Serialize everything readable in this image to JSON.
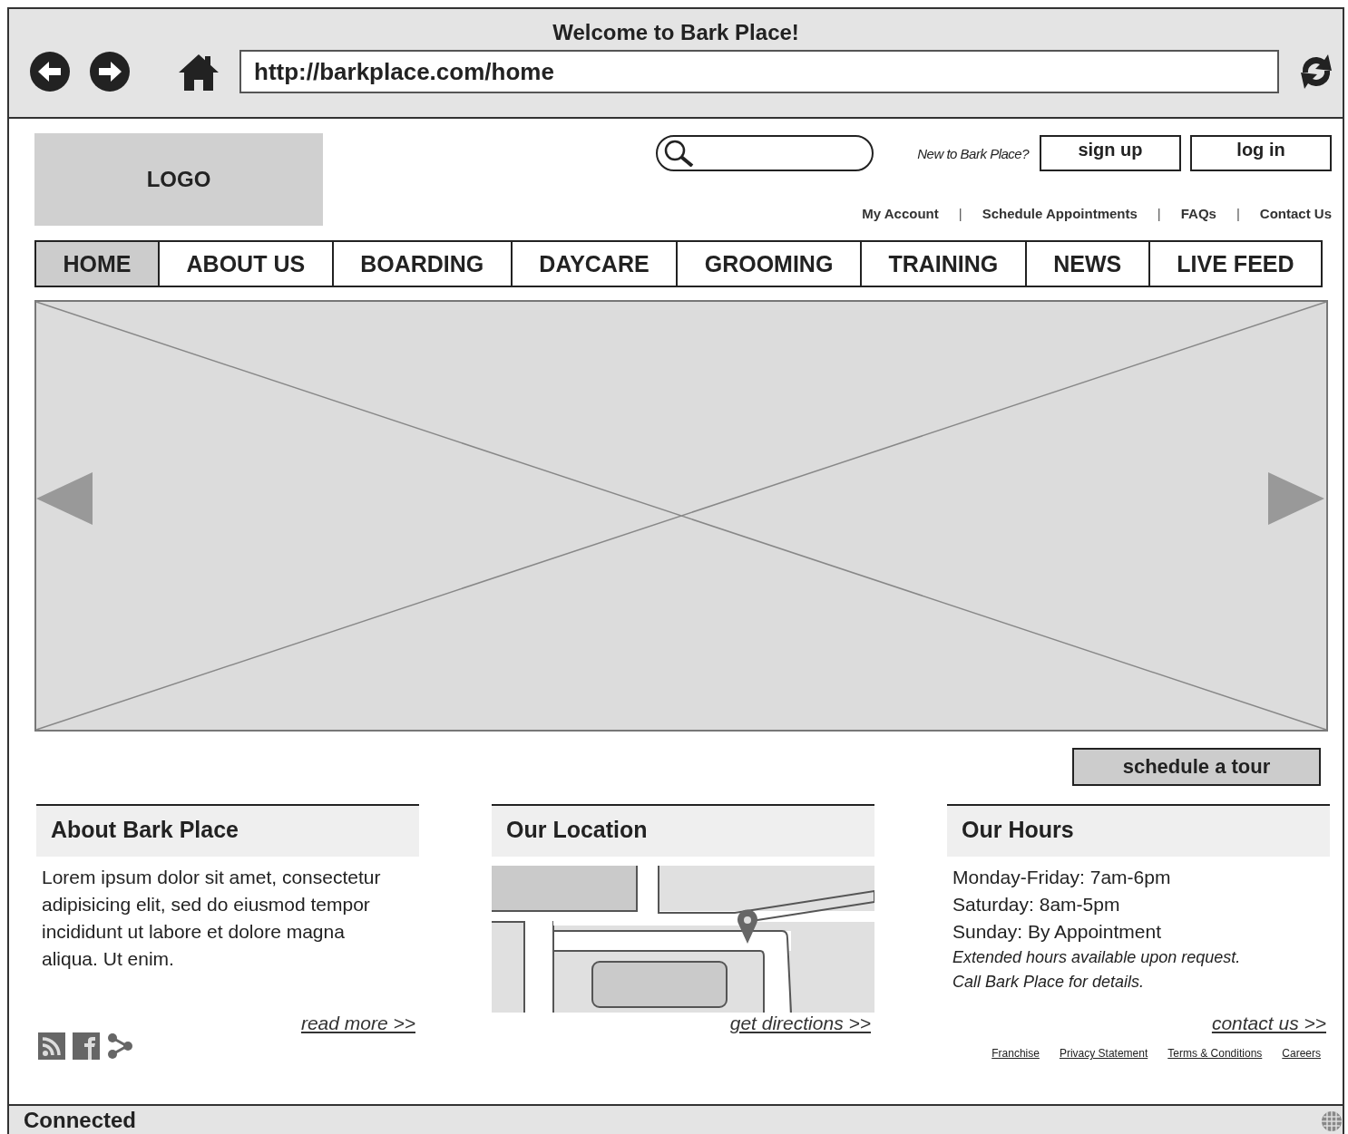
{
  "window": {
    "title": "Welcome to Bark Place!"
  },
  "address_bar": {
    "value": "http://barkplace.com/home"
  },
  "header": {
    "logo": "LOGO",
    "signup_prompt": "New to Bark Place?",
    "buttons": [
      "sign up",
      "log in"
    ],
    "links": [
      {
        "kind": "link",
        "label": "My Account"
      },
      {
        "kind": "separator",
        "label": "|"
      },
      {
        "kind": "link",
        "label": "Schedule Appointments"
      },
      {
        "kind": "separator",
        "label": "|"
      },
      {
        "kind": "link",
        "label": "FAQs"
      },
      {
        "kind": "separator",
        "label": "|"
      },
      {
        "kind": "link",
        "label": "Contact Us"
      }
    ]
  },
  "nav": [
    {
      "label": "HOME",
      "selected": true
    },
    {
      "label": "ABOUT US",
      "selected": false
    },
    {
      "label": "BOARDING",
      "selected": false
    },
    {
      "label": "DAYCARE",
      "selected": false
    },
    {
      "label": "GROOMING",
      "selected": false
    },
    {
      "label": "TRAINING",
      "selected": false
    },
    {
      "label": "NEWS",
      "selected": false
    },
    {
      "label": "LIVE FEED",
      "selected": false
    }
  ],
  "tour_button": "schedule a tour",
  "sections": [
    {
      "kind": "text",
      "title": "About Bark Place",
      "body": "Lorem ipsum dolor sit amet, consectetur adipisicing elit, sed do eiusmod tempor incididunt ut labore et dolore magna aliqua. Ut enim.",
      "link": "read more >>"
    },
    {
      "kind": "map",
      "title": "Our Location",
      "link": "get directions >>"
    },
    {
      "kind": "hours",
      "title": "Our Hours",
      "lines": [
        "Monday-Friday: 7am-6pm",
        "Saturday: 8am-5pm",
        "Sunday: By Appointment"
      ],
      "notes": [
        "Extended hours available upon request.",
        "Call Bark Place for details."
      ],
      "link": "contact us >>"
    }
  ],
  "footer_links": [
    "Franchise",
    "Privacy Statement",
    "Terms & Conditions",
    "Careers"
  ],
  "status_bar": {
    "text": "Connected"
  }
}
